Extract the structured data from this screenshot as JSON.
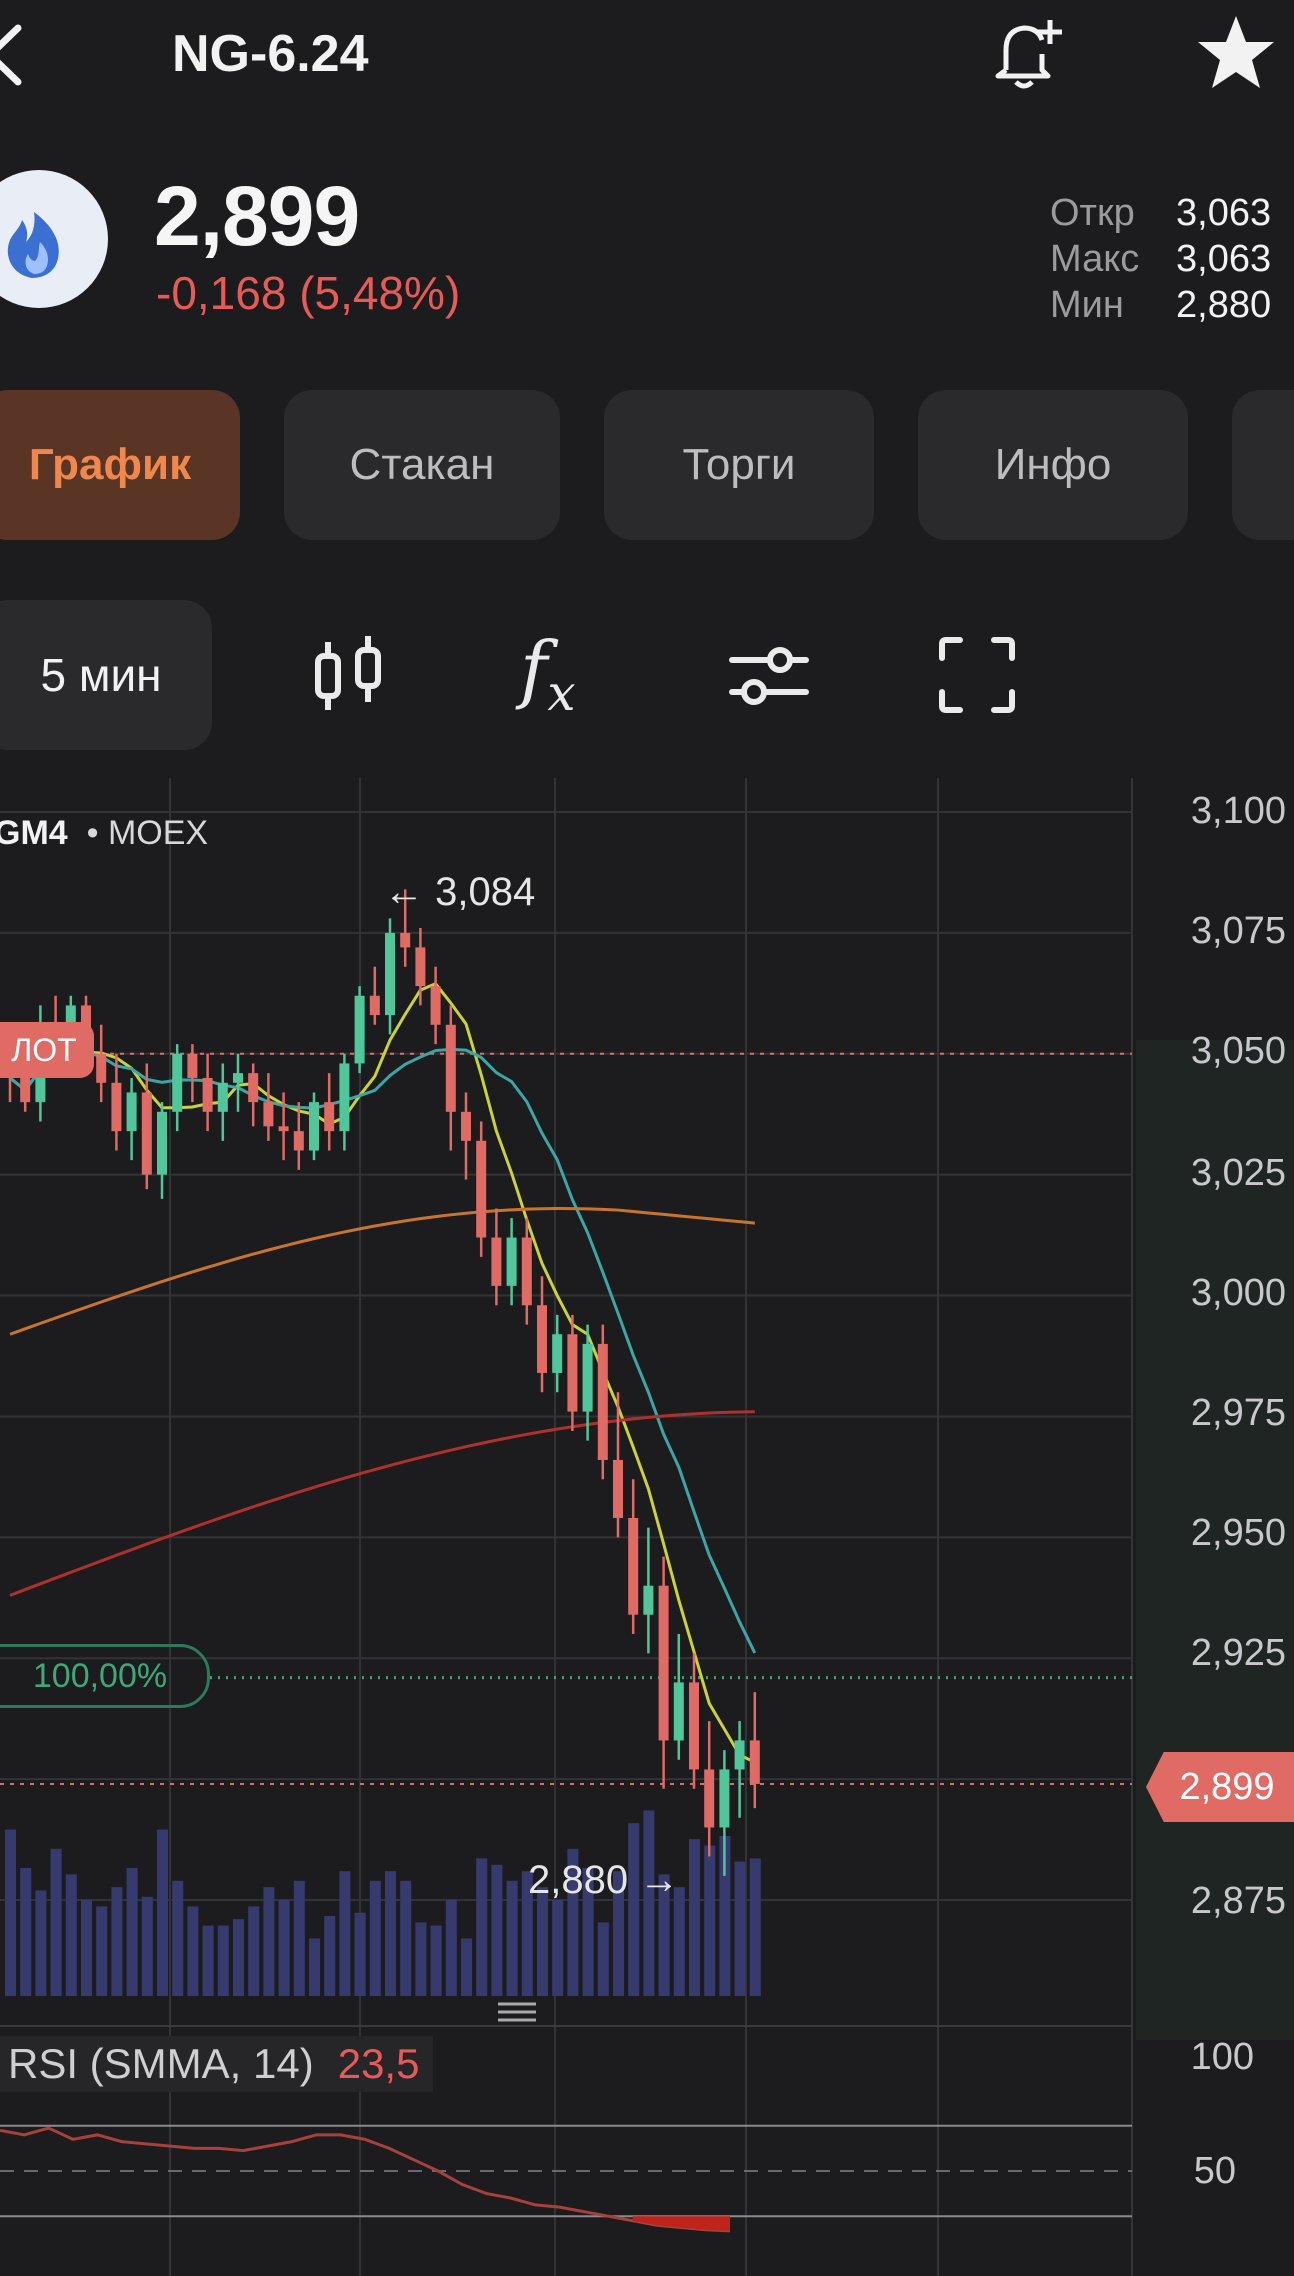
{
  "header": {
    "title": "NG-6.24"
  },
  "quote": {
    "price": "2,899",
    "change": "-0,168 (5,48%)",
    "stats": [
      {
        "label": "Откр",
        "value": "3,063"
      },
      {
        "label": "Макс",
        "value": "3,063"
      },
      {
        "label": "Мин",
        "value": "2,880"
      }
    ]
  },
  "tabs": [
    "График",
    "Стакан",
    "Торги",
    "Инфо"
  ],
  "active_tab": "График",
  "toolbar": {
    "interval": "5 мин",
    "fx_label": "f",
    "fx_sub": "x"
  },
  "chart": {
    "ticker": "GM4",
    "exchange": "• MOEX",
    "y_labels": [
      "3,100",
      "3,075",
      "3,050",
      "3,025",
      "3,000",
      "2,975",
      "2,950",
      "2,925",
      "2,899",
      "2,875"
    ],
    "high_annotation": "3,084",
    "low_annotation": "2,880",
    "current_price_tag": "2,899",
    "lot_tag": "ЛОТ",
    "percent_tag": "100,00%",
    "rsi_label": "RSI (SMMA, 14)",
    "rsi_value": "23,5",
    "rsi_y_labels": [
      "100",
      "50"
    ]
  },
  "colors": {
    "up": "#4fc79a",
    "down": "#e06a64",
    "accent": "#f0884e",
    "background": "#1c1c1e"
  },
  "chart_data": {
    "type": "line",
    "ylim": [
      2875,
      3100
    ],
    "ohlc": [
      [
        3048,
        3055,
        3040,
        3045
      ],
      [
        3045,
        3052,
        3038,
        3040
      ],
      [
        3040,
        3060,
        3036,
        3055
      ],
      [
        3055,
        3062,
        3050,
        3052
      ],
      [
        3052,
        3062,
        3047,
        3060
      ],
      [
        3060,
        3062,
        3048,
        3050
      ],
      [
        3050,
        3056,
        3040,
        3044
      ],
      [
        3044,
        3050,
        3030,
        3034
      ],
      [
        3034,
        3045,
        3028,
        3042
      ],
      [
        3042,
        3048,
        3022,
        3025
      ],
      [
        3025,
        3040,
        3020,
        3038
      ],
      [
        3038,
        3052,
        3034,
        3050
      ],
      [
        3050,
        3052,
        3040,
        3045
      ],
      [
        3045,
        3050,
        3034,
        3038
      ],
      [
        3038,
        3048,
        3032,
        3044
      ],
      [
        3044,
        3050,
        3038,
        3046
      ],
      [
        3046,
        3048,
        3035,
        3040
      ],
      [
        3040,
        3046,
        3032,
        3035
      ],
      [
        3035,
        3042,
        3028,
        3034
      ],
      [
        3034,
        3040,
        3026,
        3030
      ],
      [
        3030,
        3042,
        3028,
        3040
      ],
      [
        3040,
        3046,
        3030,
        3034
      ],
      [
        3034,
        3050,
        3030,
        3048
      ],
      [
        3048,
        3064,
        3046,
        3062
      ],
      [
        3062,
        3068,
        3056,
        3058
      ],
      [
        3058,
        3078,
        3054,
        3075
      ],
      [
        3075,
        3084,
        3068,
        3072
      ],
      [
        3072,
        3076,
        3060,
        3064
      ],
      [
        3064,
        3068,
        3052,
        3056
      ],
      [
        3056,
        3060,
        3030,
        3038
      ],
      [
        3038,
        3042,
        3024,
        3032
      ],
      [
        3032,
        3036,
        3008,
        3012
      ],
      [
        3012,
        3018,
        2998,
        3002
      ],
      [
        3002,
        3016,
        2998,
        3012
      ],
      [
        3012,
        3016,
        2994,
        2998
      ],
      [
        2998,
        3004,
        2980,
        2984
      ],
      [
        2984,
        2996,
        2980,
        2992
      ],
      [
        2992,
        2996,
        2972,
        2976
      ],
      [
        2976,
        2994,
        2970,
        2990
      ],
      [
        2990,
        2994,
        2962,
        2966
      ],
      [
        2966,
        2980,
        2950,
        2954
      ],
      [
        2954,
        2962,
        2930,
        2934
      ],
      [
        2934,
        2952,
        2926,
        2940
      ],
      [
        2940,
        2946,
        2898,
        2908
      ],
      [
        2908,
        2930,
        2904,
        2920
      ],
      [
        2920,
        2926,
        2898,
        2902
      ],
      [
        2902,
        2912,
        2884,
        2890
      ],
      [
        2890,
        2906,
        2880,
        2902
      ],
      [
        2902,
        2912,
        2892,
        2908
      ],
      [
        2908,
        2918,
        2894,
        2899
      ]
    ],
    "volume": [
      52,
      40,
      33,
      46,
      38,
      30,
      28,
      34,
      40,
      31,
      52,
      36,
      28,
      22,
      22,
      24,
      28,
      34,
      30,
      36,
      18,
      25,
      39,
      26,
      36,
      39,
      36,
      23,
      22,
      30,
      18,
      43,
      41,
      36,
      39,
      34,
      30,
      46,
      40,
      23,
      39,
      54,
      58,
      38,
      34,
      49,
      47,
      50,
      42,
      43
    ],
    "rsi": [
      68,
      66,
      69,
      64,
      66,
      63,
      62,
      61,
      60,
      60,
      59,
      61,
      63,
      66,
      66,
      64,
      60,
      55,
      50,
      44,
      40,
      38,
      35,
      34,
      32,
      30,
      28,
      26,
      25,
      24,
      23.5
    ]
  }
}
